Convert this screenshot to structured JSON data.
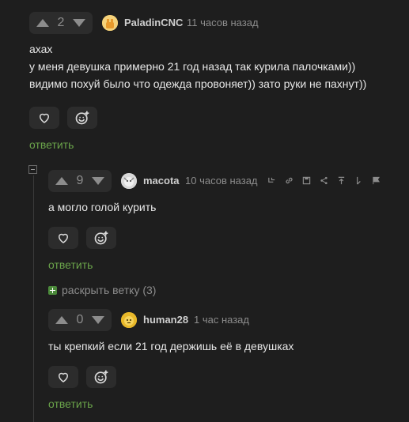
{
  "colors": {
    "background": "#1e1e1e",
    "reply_link": "#6aa34a",
    "expand_icon": "#4b8a3a"
  },
  "comment1": {
    "votes": "2",
    "author": "PaladinCNC",
    "time": "11 часов назад",
    "lines": [
      "ахах",
      "у меня девушка примерно 21 год назад так курила палочками))",
      "видимо похуй было что одежда провоняет)) зато руки не пахнут))"
    ],
    "reply": "ответить"
  },
  "comment2": {
    "votes": "9",
    "author": "macota",
    "time": "10 часов назад",
    "text": "а могло голой курить",
    "reply": "ответить",
    "toolbar_icons": [
      "thread-icon",
      "link-icon",
      "save-icon",
      "share-icon",
      "jump-up-icon",
      "jump-parent-icon",
      "report-flag-icon"
    ]
  },
  "expand_branch": {
    "label": "раскрыть ветку (3)"
  },
  "comment3": {
    "votes": "0",
    "author": "human28",
    "time": "1 час назад",
    "text": "ты крепкий если 21 год держишь её в девушках",
    "reply": "ответить"
  }
}
